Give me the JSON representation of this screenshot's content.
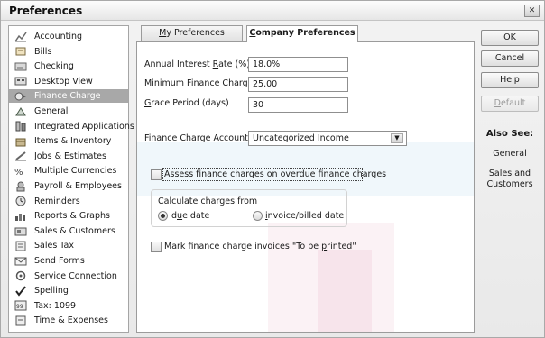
{
  "window": {
    "title": "Preferences",
    "close_glyph": "✕"
  },
  "sidebar": {
    "items": [
      {
        "label": "Accounting",
        "icon": "accounting-icon",
        "selected": false
      },
      {
        "label": "Bills",
        "icon": "bills-icon",
        "selected": false
      },
      {
        "label": "Checking",
        "icon": "checking-icon",
        "selected": false
      },
      {
        "label": "Desktop View",
        "icon": "desktop-view-icon",
        "selected": false
      },
      {
        "label": "Finance Charge",
        "icon": "finance-charge-icon",
        "selected": true
      },
      {
        "label": "General",
        "icon": "general-icon",
        "selected": false
      },
      {
        "label": "Integrated Applications",
        "icon": "integrated-applications-icon",
        "selected": false
      },
      {
        "label": "Items & Inventory",
        "icon": "items-inventory-icon",
        "selected": false
      },
      {
        "label": "Jobs & Estimates",
        "icon": "jobs-estimates-icon",
        "selected": false
      },
      {
        "label": "Multiple Currencies",
        "icon": "multiple-currencies-icon",
        "selected": false
      },
      {
        "label": "Payroll & Employees",
        "icon": "payroll-employees-icon",
        "selected": false
      },
      {
        "label": "Reminders",
        "icon": "reminders-icon",
        "selected": false
      },
      {
        "label": "Reports & Graphs",
        "icon": "reports-graphs-icon",
        "selected": false
      },
      {
        "label": "Sales & Customers",
        "icon": "sales-customers-icon",
        "selected": false
      },
      {
        "label": "Sales Tax",
        "icon": "sales-tax-icon",
        "selected": false
      },
      {
        "label": "Send Forms",
        "icon": "send-forms-icon",
        "selected": false
      },
      {
        "label": "Service Connection",
        "icon": "service-connection-icon",
        "selected": false
      },
      {
        "label": "Spelling",
        "icon": "spelling-icon",
        "selected": false
      },
      {
        "label": "Tax: 1099",
        "icon": "tax-1099-icon",
        "selected": false
      },
      {
        "label": "Time & Expenses",
        "icon": "time-expenses-icon",
        "selected": false
      }
    ]
  },
  "tabs": {
    "my_prefs": {
      "pre": "",
      "u": "M",
      "post": "y Preferences"
    },
    "company_prefs": {
      "pre": "",
      "u": "C",
      "post": "ompany Preferences"
    }
  },
  "form": {
    "annual_interest": {
      "pre": "Annual Interest ",
      "u": "R",
      "post": "ate (%)",
      "value": "18.0%"
    },
    "min_finance": {
      "pre": "Minimum Fi",
      "u": "n",
      "post": "ance Charge",
      "value": "25.00"
    },
    "grace_period": {
      "pre": "",
      "u": "G",
      "post": "race Period (days)",
      "value": "30"
    },
    "finance_account": {
      "pre": "Finance Charge ",
      "u": "A",
      "post": "ccount",
      "value": "Uncategorized Income"
    },
    "assess": {
      "pre": "A",
      "u": "s",
      "post": "sess finance charges on overdue ",
      "u2": "f",
      "post2": "inance charges",
      "checked": false
    },
    "calc_group_label": "Calculate charges from",
    "radio_due": {
      "pre": "d",
      "u": "u",
      "post": "e date",
      "selected": true
    },
    "radio_invoice": {
      "pre": "",
      "u": "i",
      "post": "nvoice/billed date",
      "selected": false
    },
    "mark_invoices": {
      "pre": "Mark finance charge invoices \"To be ",
      "u": "p",
      "post": "rinted\"",
      "checked": false
    }
  },
  "buttons": {
    "ok": "OK",
    "cancel": "Cancel",
    "help": "Help",
    "default": {
      "pre": "",
      "u": "D",
      "post": "efault"
    }
  },
  "also_see": {
    "title": "Also See:",
    "links": [
      "General",
      "Sales and Customers"
    ]
  }
}
